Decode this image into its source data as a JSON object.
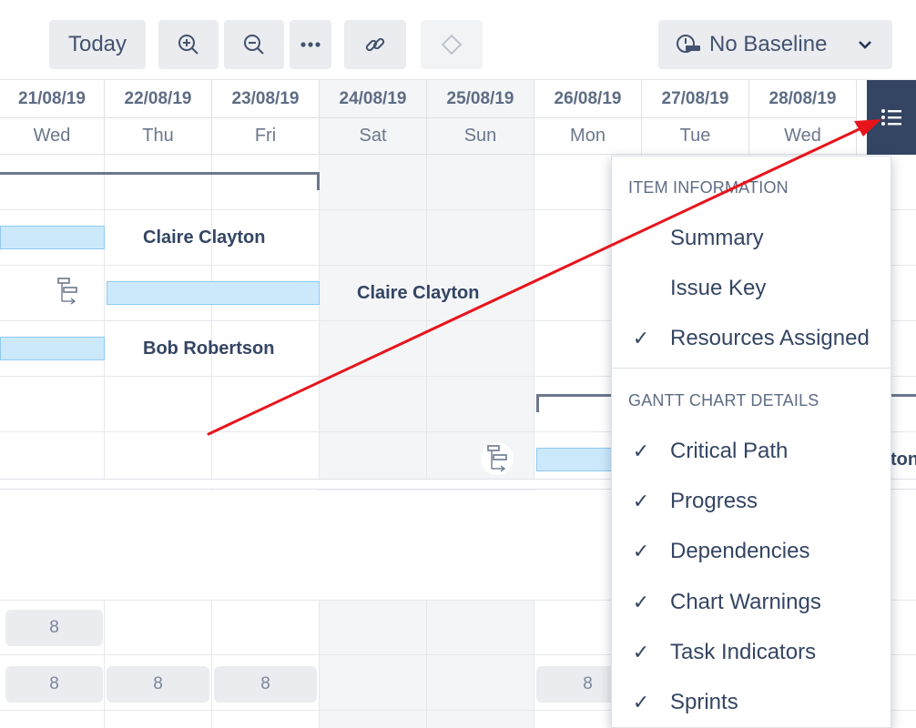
{
  "toolbar": {
    "today_label": "Today",
    "baseline_label": "No Baseline",
    "zoom_in_icon": "zoom-in-icon",
    "zoom_out_icon": "zoom-out-icon",
    "more_icon": "more-icon",
    "link_icon": "link-icon",
    "milestone_icon": "diamond-icon",
    "baseline_icon": "baseline-icon",
    "chevron_icon": "chevron-down-icon"
  },
  "timeline": {
    "dates": [
      "21/08/19",
      "22/08/19",
      "23/08/19",
      "24/08/19",
      "25/08/19",
      "26/08/19",
      "27/08/19",
      "28/08/19"
    ],
    "days": [
      "Wed",
      "Thu",
      "Fri",
      "Sat",
      "Sun",
      "Mon",
      "Tue",
      "Wed"
    ]
  },
  "settings_icon": "list-settings-icon",
  "tasks": {
    "resource_1": "Claire Clayton",
    "resource_2": "Claire Clayton",
    "resource_3": "Bob Robertson",
    "resource_4_partial": "ton"
  },
  "capacity": {
    "row1": [
      "8"
    ],
    "row2": [
      "8",
      "8",
      "8",
      "8"
    ]
  },
  "menu": {
    "item_info_title": "ITEM INFORMATION",
    "item_info": [
      {
        "label": "Summary",
        "checked": false
      },
      {
        "label": "Issue Key",
        "checked": false
      },
      {
        "label": "Resources Assigned",
        "checked": true
      }
    ],
    "gantt_title": "GANTT CHART DETAILS",
    "gantt": [
      {
        "label": "Critical Path",
        "checked": true
      },
      {
        "label": "Progress",
        "checked": true
      },
      {
        "label": "Dependencies",
        "checked": true
      },
      {
        "label": "Chart Warnings",
        "checked": true
      },
      {
        "label": "Task Indicators",
        "checked": true
      },
      {
        "label": "Sprints",
        "checked": true
      }
    ],
    "check_glyph": "✓"
  },
  "colors": {
    "accent_dark": "#344563",
    "bar_fill": "#cce9fb",
    "annotation_arrow": "#e8141c"
  }
}
